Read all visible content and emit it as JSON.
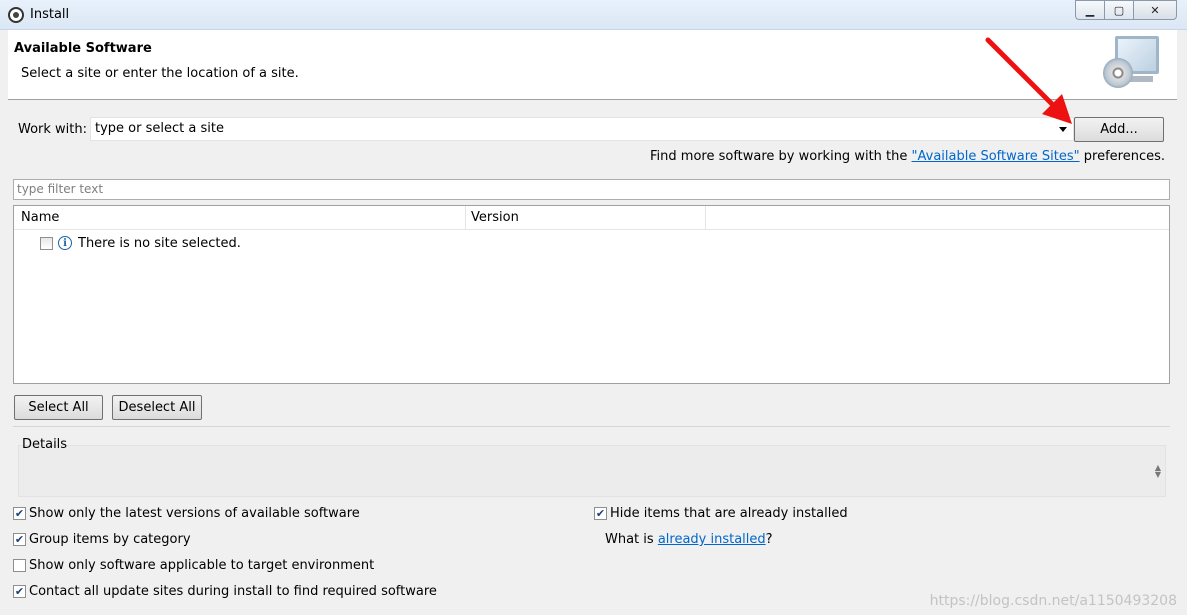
{
  "window": {
    "title": "Install"
  },
  "header": {
    "title": "Available Software",
    "subtitle": "Select a site or enter the location of a site."
  },
  "work_with": {
    "label": "Work with:",
    "value": "type or select a site",
    "add_button": "Add..."
  },
  "find_more": {
    "prefix": "Find more software by working with the ",
    "link": "\"Available Software Sites\"",
    "suffix": " preferences."
  },
  "filter": {
    "placeholder": "type filter text"
  },
  "tree": {
    "columns": [
      "Name",
      "Version"
    ],
    "empty_message": "There is no site selected."
  },
  "buttons": {
    "select_all": "Select All",
    "deselect_all": "Deselect All"
  },
  "details": {
    "title": "Details"
  },
  "options": {
    "latest_versions": {
      "label": "Show only the latest versions of available software",
      "checked": true
    },
    "group_by_category": {
      "label": "Group items by category",
      "checked": true
    },
    "applicable_only": {
      "label": "Show only software applicable to target environment",
      "checked": false
    },
    "contact_all": {
      "label": "Contact all update sites during install to find required software",
      "checked": true
    },
    "hide_installed": {
      "label": "Hide items that are already installed",
      "checked": true
    }
  },
  "already_installed": {
    "prefix": "What is ",
    "link": "already installed",
    "suffix": "?"
  },
  "watermark": "https://blog.csdn.net/a1150493208"
}
